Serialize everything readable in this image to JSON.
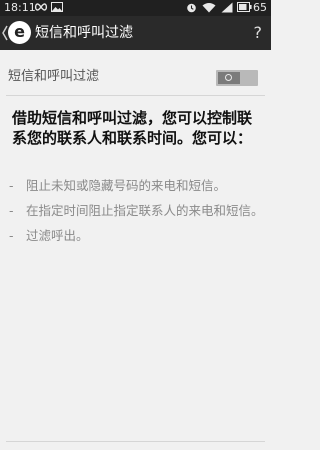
{
  "status_bar": {
    "time": "18:11",
    "battery": "65"
  },
  "app_bar": {
    "logo_letter": "e",
    "title": "短信和呼叫过滤",
    "help_label": "?"
  },
  "setting": {
    "label": "短信和呼叫过滤",
    "toggle_enabled": false
  },
  "description": {
    "title": "借助短信和呼叫过滤，您可以控制联系您的联系人和联系时间。您可以：",
    "bullet_marker": "-",
    "items": [
      "阻止未知或隐藏号码的来电和短信。",
      "在指定时间阻止指定联系人的来电和短信。",
      "过滤呼出。"
    ]
  }
}
